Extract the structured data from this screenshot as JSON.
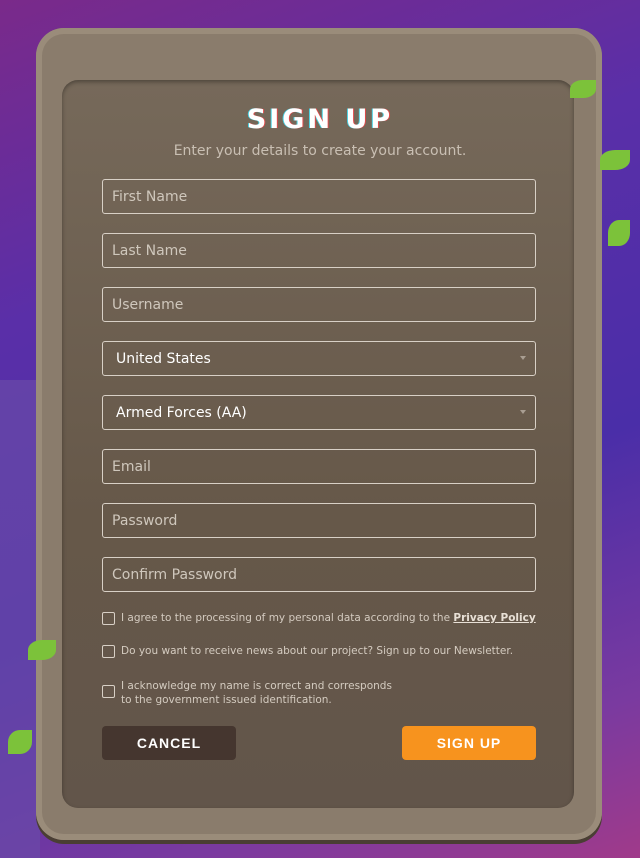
{
  "title": "SIGN UP",
  "subtitle": "Enter your details to create your account.",
  "fields": [
    {
      "placeholder": "First Name"
    },
    {
      "placeholder": "Last Name"
    },
    {
      "placeholder": "Username"
    },
    {
      "selected": "United States"
    },
    {
      "selected": "Armed Forces (AA)"
    },
    {
      "placeholder": "Email"
    },
    {
      "placeholder": "Password"
    },
    {
      "placeholder": "Confirm Password"
    }
  ],
  "checkboxes": [
    {
      "label": "I agree to the processing of my personal data according to the ",
      "link": "Privacy Policy",
      "checked": false
    },
    {
      "label": "Do you want to receive news about our project? Sign up to our Newsletter.",
      "checked": false
    },
    {
      "label": "I acknowledge my name is correct and corresponds",
      "label2": "to the government issued identification.",
      "checked": false
    }
  ],
  "buttons": {
    "cancel": "CANCEL",
    "signup": "SIGN UP"
  },
  "colors": {
    "accent": "#f7931e",
    "cancel": "#45362f"
  }
}
